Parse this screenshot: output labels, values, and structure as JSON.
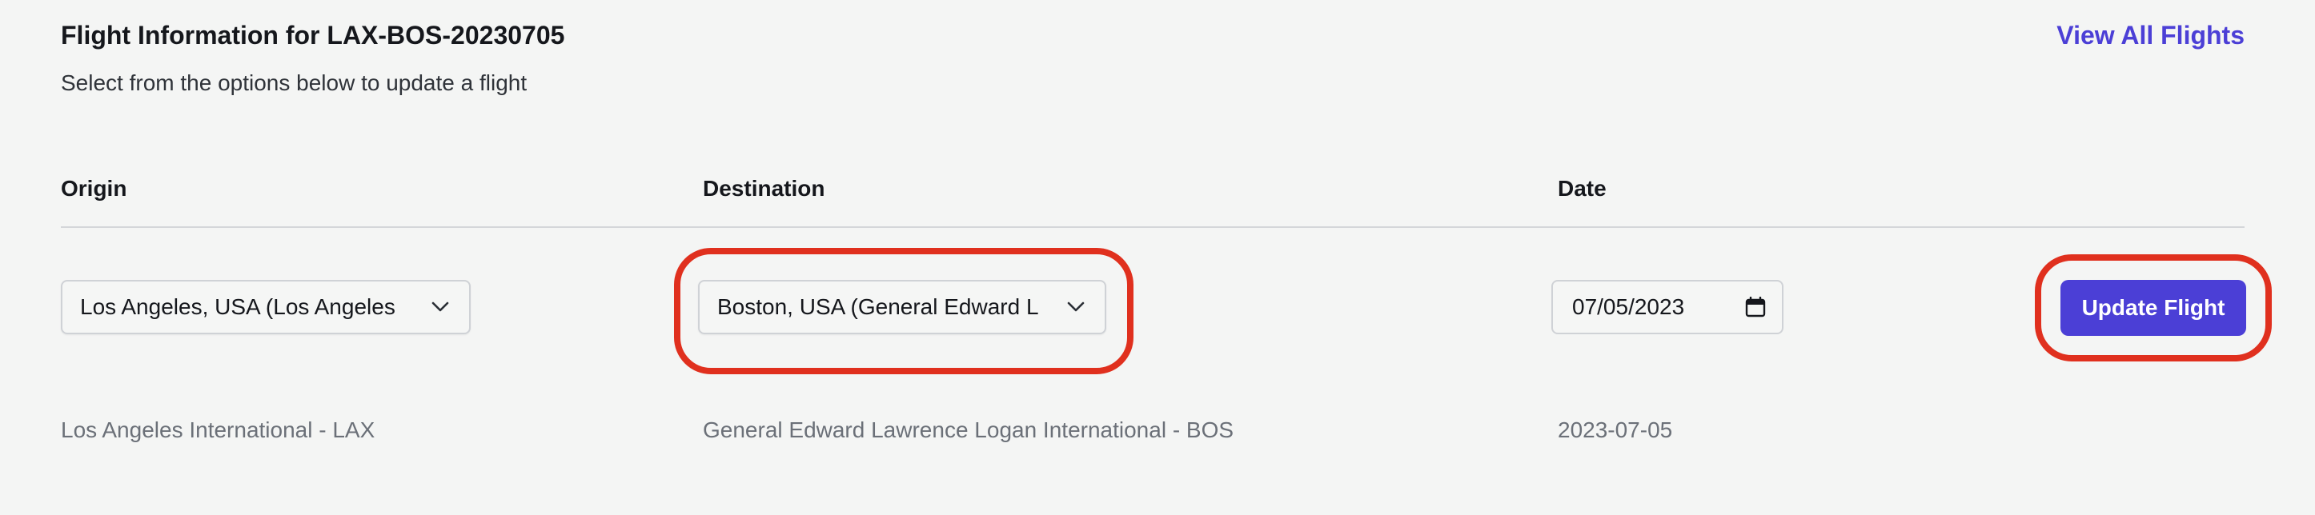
{
  "header": {
    "title": "Flight Information for LAX-BOS-20230705",
    "subtitle": "Select from the options below to update a flight",
    "view_all_label": "View All Flights"
  },
  "columns": {
    "origin": "Origin",
    "destination": "Destination",
    "date": "Date"
  },
  "form": {
    "origin_value": "Los Angeles, USA (Los Angeles",
    "destination_value": "Boston, USA (General Edward L",
    "date_value": "07/05/2023",
    "update_label": "Update Flight"
  },
  "details": {
    "origin": "Los Angeles International - LAX",
    "destination": "General Edward Lawrence Logan International - BOS",
    "date": "2023-07-05"
  },
  "icons": {
    "select_chevron": "chevron-down-icon",
    "date_picker": "calendar-icon"
  },
  "colors": {
    "accent": "#4b3fd6",
    "highlight": "#e0301e",
    "background": "#f4f5f4",
    "muted_text": "#6b7078"
  }
}
